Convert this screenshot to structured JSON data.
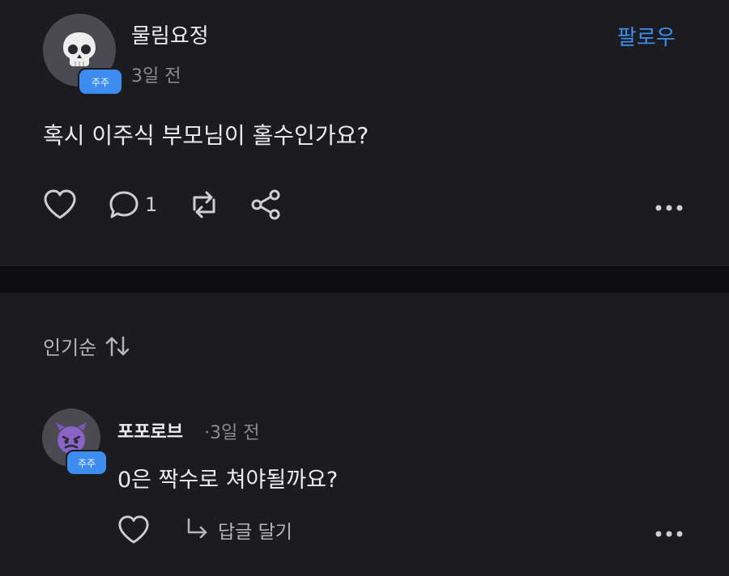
{
  "post": {
    "username": "물림요정",
    "time": "3일 전",
    "badge": "주주",
    "follow_label": "팔로우",
    "text": "혹시 이주식 부모님이 홀수인가요?",
    "comment_count": "1",
    "avatar_icon": "skull-icon"
  },
  "comments_section": {
    "sort_label": "인기순",
    "sort_icon": "sort-arrows-icon"
  },
  "comments": [
    {
      "username": "포포로브",
      "time": "·3일 전",
      "badge": "주주",
      "text": "0은 짝수로 쳐야될까요?",
      "reply_label": "답글 달기",
      "avatar_icon": "devil-face-icon"
    }
  ],
  "colors": {
    "background": "#1c1c20",
    "separator": "#0e0e10",
    "accent": "#3d8cf0",
    "muted_text": "#8a8a90",
    "avatar_bg": "#4a4a50"
  }
}
